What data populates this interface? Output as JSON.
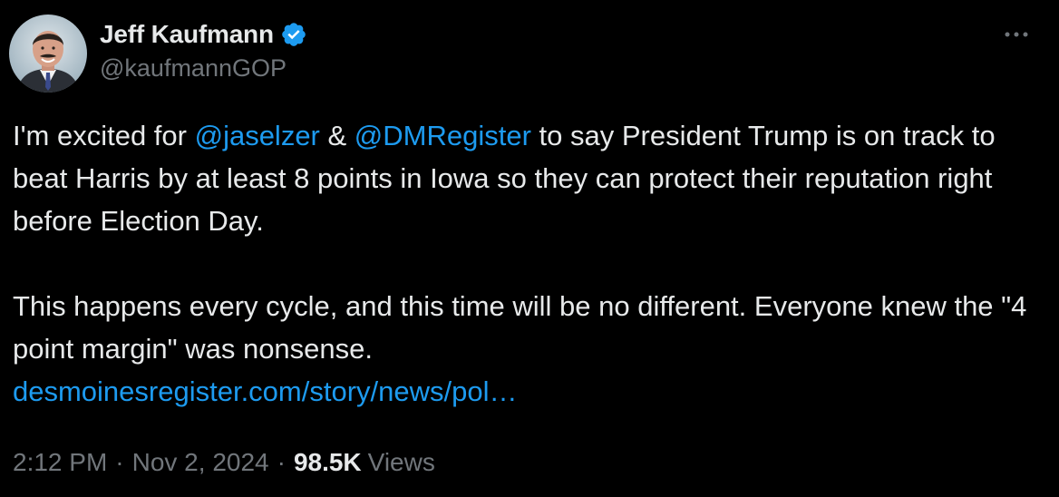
{
  "author": {
    "display_name": "Jeff Kaufmann",
    "handle": "@kaufmannGOP",
    "verified": true,
    "avatar_icon": "profile-photo"
  },
  "more_icon": "more-dots-icon",
  "body": {
    "p1": {
      "before": "I'm excited for ",
      "mention1": "@jaselzer",
      "mid": " & ",
      "mention2": "@DMRegister",
      "after": " to say President Trump is on track to beat Harris by at least 8 points in Iowa so they can protect their reputation right before Election Day."
    },
    "p2": {
      "text": "This happens every cycle, and this time will be no different. Everyone knew the \"4 point margin\" was nonsense.",
      "link": "desmoinesregister.com/story/news/pol…"
    }
  },
  "meta": {
    "time": "2:12 PM",
    "separator": "·",
    "date": "Nov 2, 2024",
    "views_count": "98.5K",
    "views_label": "Views"
  },
  "colors": {
    "background": "#000000",
    "text": "#e7e9ea",
    "secondary": "#71767b",
    "link": "#1d9bf0",
    "verified": "#1d9bf0"
  }
}
